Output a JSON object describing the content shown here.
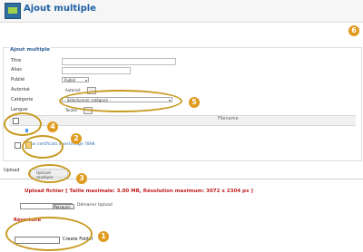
{
  "header": {
    "title": "Ajout multiple"
  },
  "form": {
    "legend": "Ajout multiple",
    "fields": {
      "titre": "Titre",
      "alias": "Alias",
      "publie": "Publié",
      "publie_value": "Publié",
      "autorise": "Autorisé",
      "autorise_value": "Autorisé",
      "categorie": "Catégorie",
      "categorie_placeholder": "- Sélectionner catégorie -",
      "langue": "Langue",
      "langue_value": "Toutes"
    },
    "table": {
      "filename_header": "Filename",
      "file_row_text": "ar certificats insertimage 7898"
    }
  },
  "tabs": {
    "upload": "Upload",
    "upload_multiple": "Upload multiple"
  },
  "upload": {
    "title": "Upload fichier [ Taille maximale: 3.00 MB, Résolution maximum: 3072 x 2304 px ]",
    "browse": "Parcourir...",
    "start_upload": "Démarrer Upload"
  },
  "repertoire": {
    "title": "Répertoire",
    "create_folder": "Create Folder"
  },
  "annotations": [
    "1",
    "2",
    "3",
    "4",
    "5",
    "6"
  ]
}
